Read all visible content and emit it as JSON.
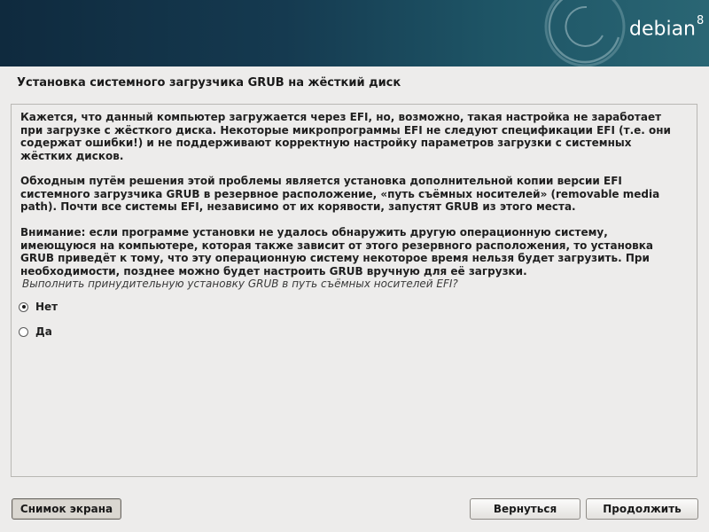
{
  "header": {
    "brand_name": "debian",
    "brand_version": "8",
    "logo_icon": "debian-swirl-icon"
  },
  "page": {
    "title": "Установка системного загрузчика GRUB на жёсткий диск"
  },
  "content": {
    "paragraphs": [
      "Кажется, что данный компьютер загружается через EFI, но, возможно, такая настройка не заработает при загрузке с жёсткого диска. Некоторые микропрограммы EFI не следуют спецификации EFI (т.е. они содержат ошибки!) и не поддерживают корректную настройку параметров загрузки с системных жёстких дисков.",
      "Обходным путём решения этой проблемы является установка дополнительной копии версии EFI системного загрузчика GRUB в резервное расположение, «путь съёмных носителей» (removable media path). Почти все системы EFI, независимо от их корявости, запустят GRUB из этого места.",
      "Внимание: если программе установки не удалось обнаружить другую операционную систему, имеющуюся на компьютере, которая также зависит от этого резервного расположения, то установка GRUB приведёт к тому, что эту операционную систему некоторое время нельзя будет загрузить. При необходимости, позднее можно будет настроить GRUB вручную для её загрузки."
    ],
    "question": "Выполнить принудительную установку GRUB в путь съёмных носителей EFI?",
    "options": [
      {
        "label": "Нет",
        "selected": true
      },
      {
        "label": "Да",
        "selected": false
      }
    ]
  },
  "buttons": {
    "screenshot": "Снимок экрана",
    "back": "Вернуться",
    "continue": "Продолжить"
  },
  "colors": {
    "header_dark": "#0f2a3e",
    "header_light": "#2a6674",
    "background": "#edeceb"
  }
}
